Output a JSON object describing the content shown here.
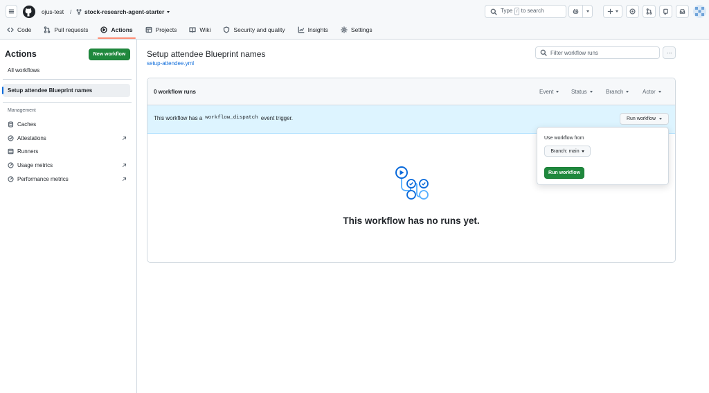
{
  "header": {
    "owner": "ojus-test",
    "separator": "/",
    "repo": "stock-research-agent-starter",
    "search_prefix": "Type",
    "search_key": "/",
    "search_suffix": "to search"
  },
  "tabs": [
    {
      "label": "Code",
      "icon": "code-icon"
    },
    {
      "label": "Pull requests",
      "icon": "pull-request-icon"
    },
    {
      "label": "Actions",
      "icon": "play-icon",
      "active": true
    },
    {
      "label": "Projects",
      "icon": "table-icon"
    },
    {
      "label": "Wiki",
      "icon": "book-icon"
    },
    {
      "label": "Security and quality",
      "icon": "shield-icon"
    },
    {
      "label": "Insights",
      "icon": "graph-icon"
    },
    {
      "label": "Settings",
      "icon": "gear-icon"
    }
  ],
  "sidebar": {
    "title": "Actions",
    "new_workflow": "New workflow",
    "all_workflows": "All workflows",
    "selected_workflow": "Setup attendee Blueprint names",
    "management_heading": "Management",
    "items": [
      {
        "label": "Caches",
        "icon": "database-icon",
        "external": false
      },
      {
        "label": "Attestations",
        "icon": "verified-icon",
        "external": true
      },
      {
        "label": "Runners",
        "icon": "server-icon",
        "external": false
      },
      {
        "label": "Usage metrics",
        "icon": "meter-icon",
        "external": true
      },
      {
        "label": "Performance metrics",
        "icon": "meter-icon",
        "external": true
      }
    ]
  },
  "main": {
    "title": "Setup attendee Blueprint names",
    "file": "setup-attendee.yml",
    "filter_placeholder": "Filter workflow runs",
    "more": "···",
    "runs_count": "0 workflow runs",
    "filters": [
      "Event",
      "Status",
      "Branch",
      "Actor"
    ],
    "dispatch_prefix": "This workflow has a",
    "dispatch_code": "workflow_dispatch",
    "dispatch_suffix": "event trigger.",
    "run_workflow_dropdown": "Run workflow",
    "empty_message": "This workflow has no runs yet."
  },
  "popup": {
    "label": "Use workflow from",
    "branch_button": "Branch: main",
    "run_button": "Run workflow"
  },
  "colors": {
    "primary_button": "#1f883d",
    "link": "#0969da",
    "active_tab_underline": "#fd8c73",
    "dispatch_banner": "#ddf4ff"
  }
}
